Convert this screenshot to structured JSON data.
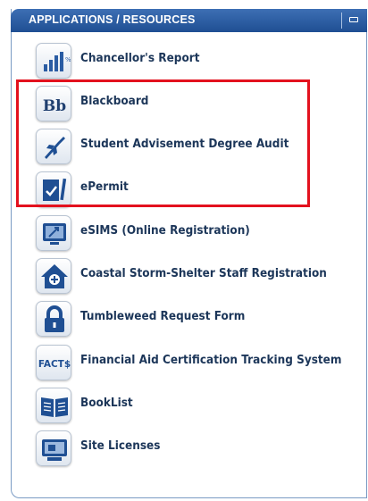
{
  "header": {
    "title": "APPLICATIONS / RESOURCES"
  },
  "items": [
    {
      "label": "Chancellor's Report",
      "icon": "bar-chart-icon"
    },
    {
      "label": "Blackboard",
      "icon": "blackboard-icon",
      "icon_text": "Bb"
    },
    {
      "label": "Student Advisement Degree Audit",
      "icon": "rocket-icon"
    },
    {
      "label": "ePermit",
      "icon": "document-check-icon"
    },
    {
      "label": "eSIMS (Online Registration)",
      "icon": "monitor-icon"
    },
    {
      "label": "Coastal Storm-Shelter Staff Registration",
      "icon": "shelter-icon"
    },
    {
      "label": "Tumbleweed Request Form",
      "icon": "lock-icon"
    },
    {
      "label": "Financial Aid Certification Tracking System",
      "icon": "facts-icon",
      "icon_text": "FACT$"
    },
    {
      "label": "BookList",
      "icon": "book-icon"
    },
    {
      "label": "Site Licenses",
      "icon": "computer-icon"
    }
  ],
  "colors": {
    "header": "#2a5ca3",
    "highlight": "#e3111e",
    "label": "#1c3659"
  }
}
